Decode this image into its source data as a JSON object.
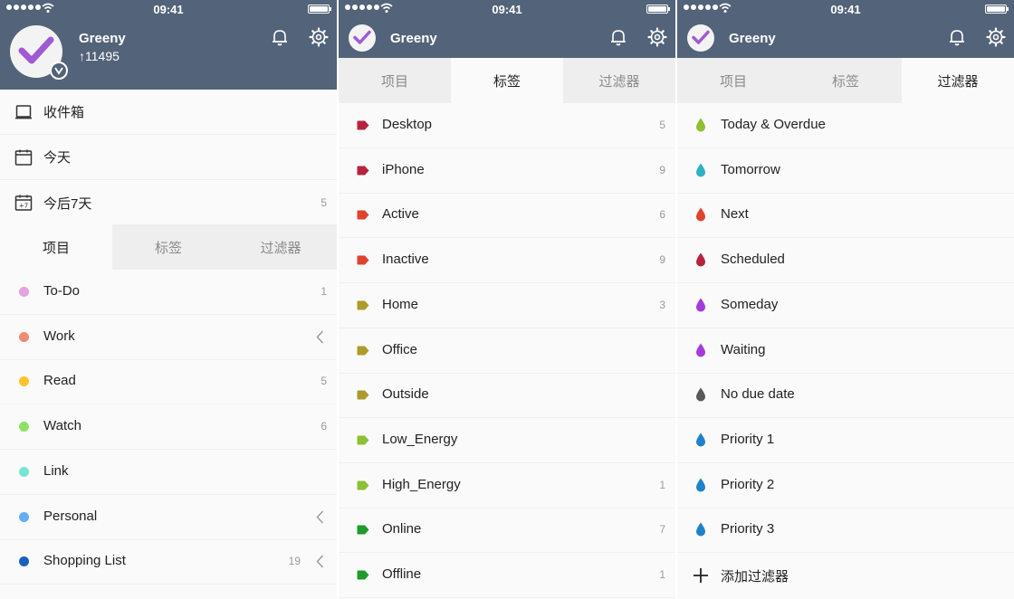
{
  "status_bar": {
    "time": "09:41"
  },
  "user": {
    "name": "Greeny",
    "karma": "↑11495"
  },
  "nav": {
    "inbox": {
      "label": "收件箱"
    },
    "today": {
      "label": "今天"
    },
    "next7": {
      "label": "今后7天",
      "count": "5",
      "icon_text": "+7"
    }
  },
  "tabs": {
    "projects": "项目",
    "labels": "标签",
    "filters": "过滤器"
  },
  "projects": [
    {
      "name": "To-Do",
      "color": "#e2a3e0",
      "count": "1",
      "chevron": false
    },
    {
      "name": "Work",
      "color": "#f08b72",
      "count": "",
      "chevron": true
    },
    {
      "name": "Read",
      "color": "#fbc52c",
      "count": "5",
      "chevron": false
    },
    {
      "name": "Watch",
      "color": "#8fe067",
      "count": "6",
      "chevron": false
    },
    {
      "name": "Link",
      "color": "#79e3d4",
      "count": "",
      "chevron": false
    },
    {
      "name": "Personal",
      "color": "#64aef4",
      "count": "",
      "chevron": true
    },
    {
      "name": "Shopping List",
      "color": "#1b5fbd",
      "count": "19",
      "chevron": true
    }
  ],
  "labels": [
    {
      "name": "Desktop",
      "color": "#b7233f",
      "count": "5"
    },
    {
      "name": "iPhone",
      "color": "#b7233f",
      "count": "9"
    },
    {
      "name": "Active",
      "color": "#e0432c",
      "count": "6"
    },
    {
      "name": "Inactive",
      "color": "#e0432c",
      "count": "9"
    },
    {
      "name": "Home",
      "color": "#ad9a2a",
      "count": "3"
    },
    {
      "name": "Office",
      "color": "#ad9a2a",
      "count": ""
    },
    {
      "name": "Outside",
      "color": "#ad9a2a",
      "count": ""
    },
    {
      "name": "Low_Energy",
      "color": "#8dc034",
      "count": ""
    },
    {
      "name": "High_Energy",
      "color": "#8dc034",
      "count": "1"
    },
    {
      "name": "Online",
      "color": "#1f9a2b",
      "count": "7"
    },
    {
      "name": "Offline",
      "color": "#1f9a2b",
      "count": "1"
    }
  ],
  "filters": [
    {
      "name": "Today & Overdue",
      "color": "#8dc034"
    },
    {
      "name": "Tomorrow",
      "color": "#2fb0c4"
    },
    {
      "name": "Next",
      "color": "#e0432c"
    },
    {
      "name": "Scheduled",
      "color": "#b7233f"
    },
    {
      "name": "Someday",
      "color": "#a53bd8"
    },
    {
      "name": "Waiting",
      "color": "#a53bd8"
    },
    {
      "name": "No due date",
      "color": "#5a5a5a"
    },
    {
      "name": "Priority 1",
      "color": "#1f82c9"
    },
    {
      "name": "Priority 2",
      "color": "#1f82c9"
    },
    {
      "name": "Priority 3",
      "color": "#1f82c9"
    }
  ],
  "add_filter": {
    "label": "添加过滤器"
  },
  "icons": {
    "logo": "checkmark-logo-icon",
    "notifications": "bell-icon",
    "settings": "gear-icon",
    "inbox": "inbox-tray-icon",
    "today": "calendar-icon",
    "next7": "calendar-plus7-icon",
    "expand": "chevron-left-icon",
    "add": "plus-icon"
  },
  "colors": {
    "header": "#536379",
    "accent": "#a05ad5"
  }
}
